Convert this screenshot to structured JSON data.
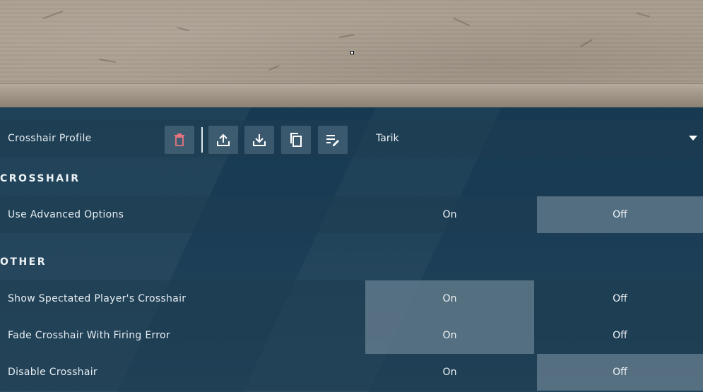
{
  "profile": {
    "label": "Crosshair Profile",
    "selected": "Tarik",
    "icons": [
      "trash-icon",
      "upload-icon",
      "download-icon",
      "copy-icon",
      "rename-icon"
    ]
  },
  "sections": {
    "crosshair": "CROSSHAIR",
    "other": "OTHER"
  },
  "settings": {
    "advanced": {
      "label": "Use Advanced Options",
      "on": "On",
      "off": "Off",
      "value": "Off"
    },
    "spectated": {
      "label": "Show Spectated Player's Crosshair",
      "on": "On",
      "off": "Off",
      "value": "On"
    },
    "fade": {
      "label": "Fade Crosshair With Firing Error",
      "on": "On",
      "off": "Off",
      "value": "On"
    },
    "disable": {
      "label": "Disable Crosshair",
      "on": "On",
      "off": "Off",
      "value": "Off"
    }
  },
  "colors": {
    "trash": "#e9747f",
    "accent_selected": "#96aab9"
  }
}
